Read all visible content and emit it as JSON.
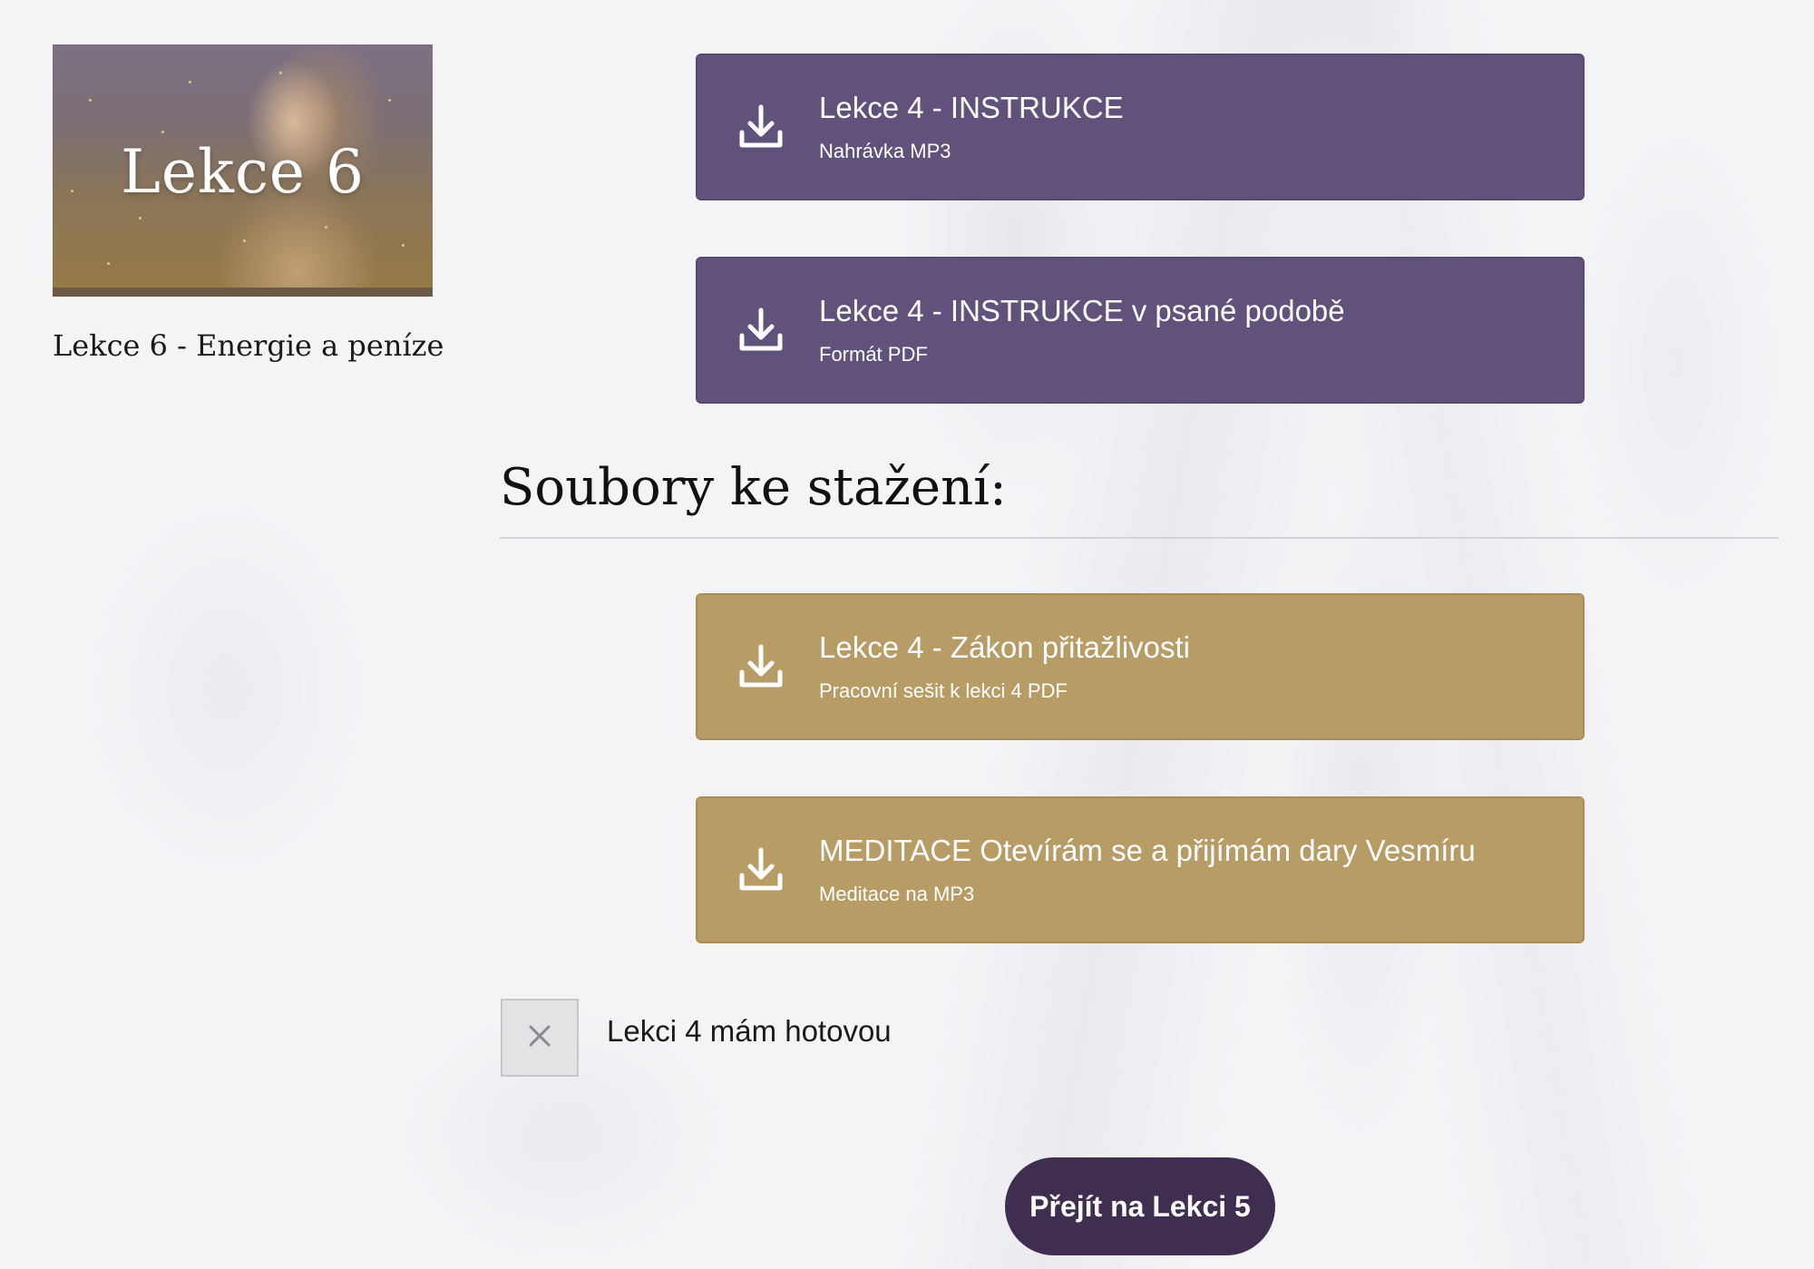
{
  "lesson_card": {
    "image_title": "Lekce 6",
    "caption": "Lekce 6 - Energie a peníze"
  },
  "downloads_top": [
    {
      "title": "Lekce 4 - INSTRUKCE",
      "subtitle": "Nahrávka MP3",
      "icon": "download-icon",
      "color": "#60527a"
    },
    {
      "title": "Lekce 4 - INSTRUKCE v psané podobě",
      "subtitle": "Formát PDF",
      "icon": "download-icon",
      "color": "#60527a"
    }
  ],
  "files_section": {
    "heading": "Soubory ke stažení:"
  },
  "downloads_files": [
    {
      "title": "Lekce 4 - Zákon přitažlivosti",
      "subtitle": "Pracovní sešit k lekci 4 PDF",
      "icon": "download-icon",
      "color": "#b89c65"
    },
    {
      "title": "MEDITACE Otevírám se a přijímám dary Vesmíru",
      "subtitle": "Meditace na MP3",
      "icon": "download-icon",
      "color": "#b89c65"
    }
  ],
  "completion": {
    "label": "Lekci 4 mám hotovou",
    "checked": false,
    "icon": "close-icon"
  },
  "next_button": {
    "label": "Přejít na Lekci 5",
    "color": "#3f2e4f"
  }
}
